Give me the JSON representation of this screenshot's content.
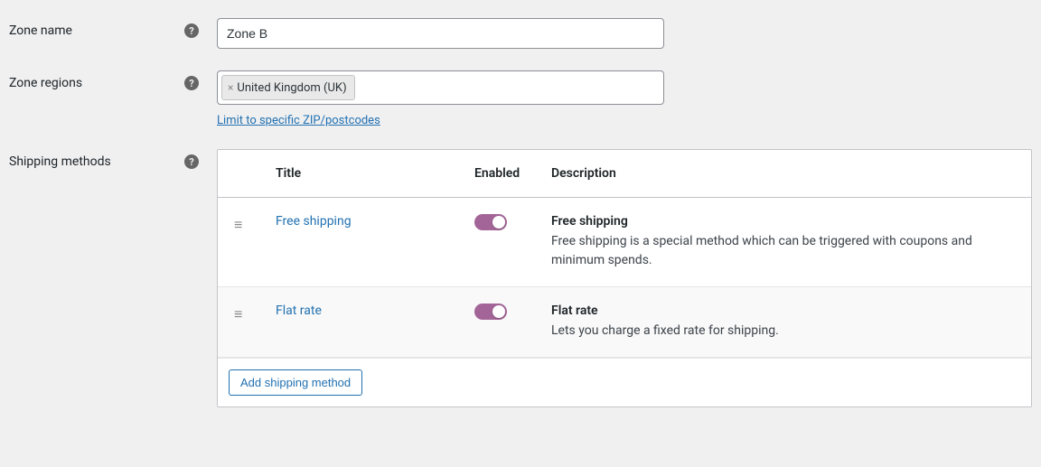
{
  "zone_name": {
    "label": "Zone name",
    "value": "Zone B"
  },
  "zone_regions": {
    "label": "Zone regions",
    "tags": [
      "United Kingdom (UK)"
    ],
    "limit_link": "Limit to specific ZIP/postcodes"
  },
  "shipping_methods": {
    "label": "Shipping methods",
    "columns": {
      "title": "Title",
      "enabled": "Enabled",
      "description": "Description"
    },
    "rows": [
      {
        "title": "Free shipping",
        "enabled": true,
        "desc_title": "Free shipping",
        "desc_text": "Free shipping is a special method which can be triggered with coupons and minimum spends."
      },
      {
        "title": "Flat rate",
        "enabled": true,
        "desc_title": "Flat rate",
        "desc_text": "Lets you charge a fixed rate for shipping."
      }
    ],
    "add_button": "Add shipping method"
  }
}
